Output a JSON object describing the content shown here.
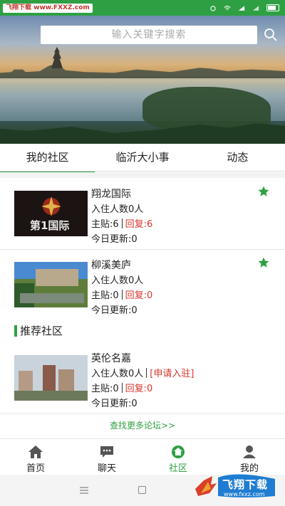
{
  "status_bar": {
    "watermark_text": "飞翔下载 www.FXXZ.com"
  },
  "search": {
    "placeholder": "输入关键字搜索"
  },
  "tabs": [
    {
      "label": "我的社区",
      "active": true
    },
    {
      "label": "临沂大小事",
      "active": false
    },
    {
      "label": "动态",
      "active": false
    }
  ],
  "my_communities": [
    {
      "name": "翔龙国际",
      "residents": "入住人数0人",
      "posts_label": "主贴:6",
      "replies_label": "回复:6",
      "today": "今日更新:0",
      "starred": true,
      "thumb_text": "第1国际"
    },
    {
      "name": "柳溪美庐",
      "residents": "入住人数0人",
      "posts_label": "主贴:0",
      "replies_label": "回复:0",
      "today": "今日更新:0",
      "starred": true
    }
  ],
  "recommended": {
    "title": "推荐社区",
    "items": [
      {
        "name": "英伦名嘉",
        "residents": "入住人数0人",
        "apply_label": "[申请入驻]",
        "posts_label": "主贴:0",
        "replies_label": "回复:0",
        "today": "今日更新:0"
      }
    ]
  },
  "more_link": "查找更多论坛>>",
  "bottom_nav": [
    {
      "label": "首页",
      "icon": "home-icon",
      "active": false
    },
    {
      "label": "聊天",
      "icon": "chat-icon",
      "active": false
    },
    {
      "label": "社区",
      "icon": "community-icon",
      "active": true
    },
    {
      "label": "我的",
      "icon": "profile-icon",
      "active": false
    }
  ],
  "watermark_logo": {
    "title": "飞翔下载",
    "url": "www.fxxz.com"
  },
  "colors": {
    "accent": "#2ea043",
    "red": "#d9352b"
  }
}
